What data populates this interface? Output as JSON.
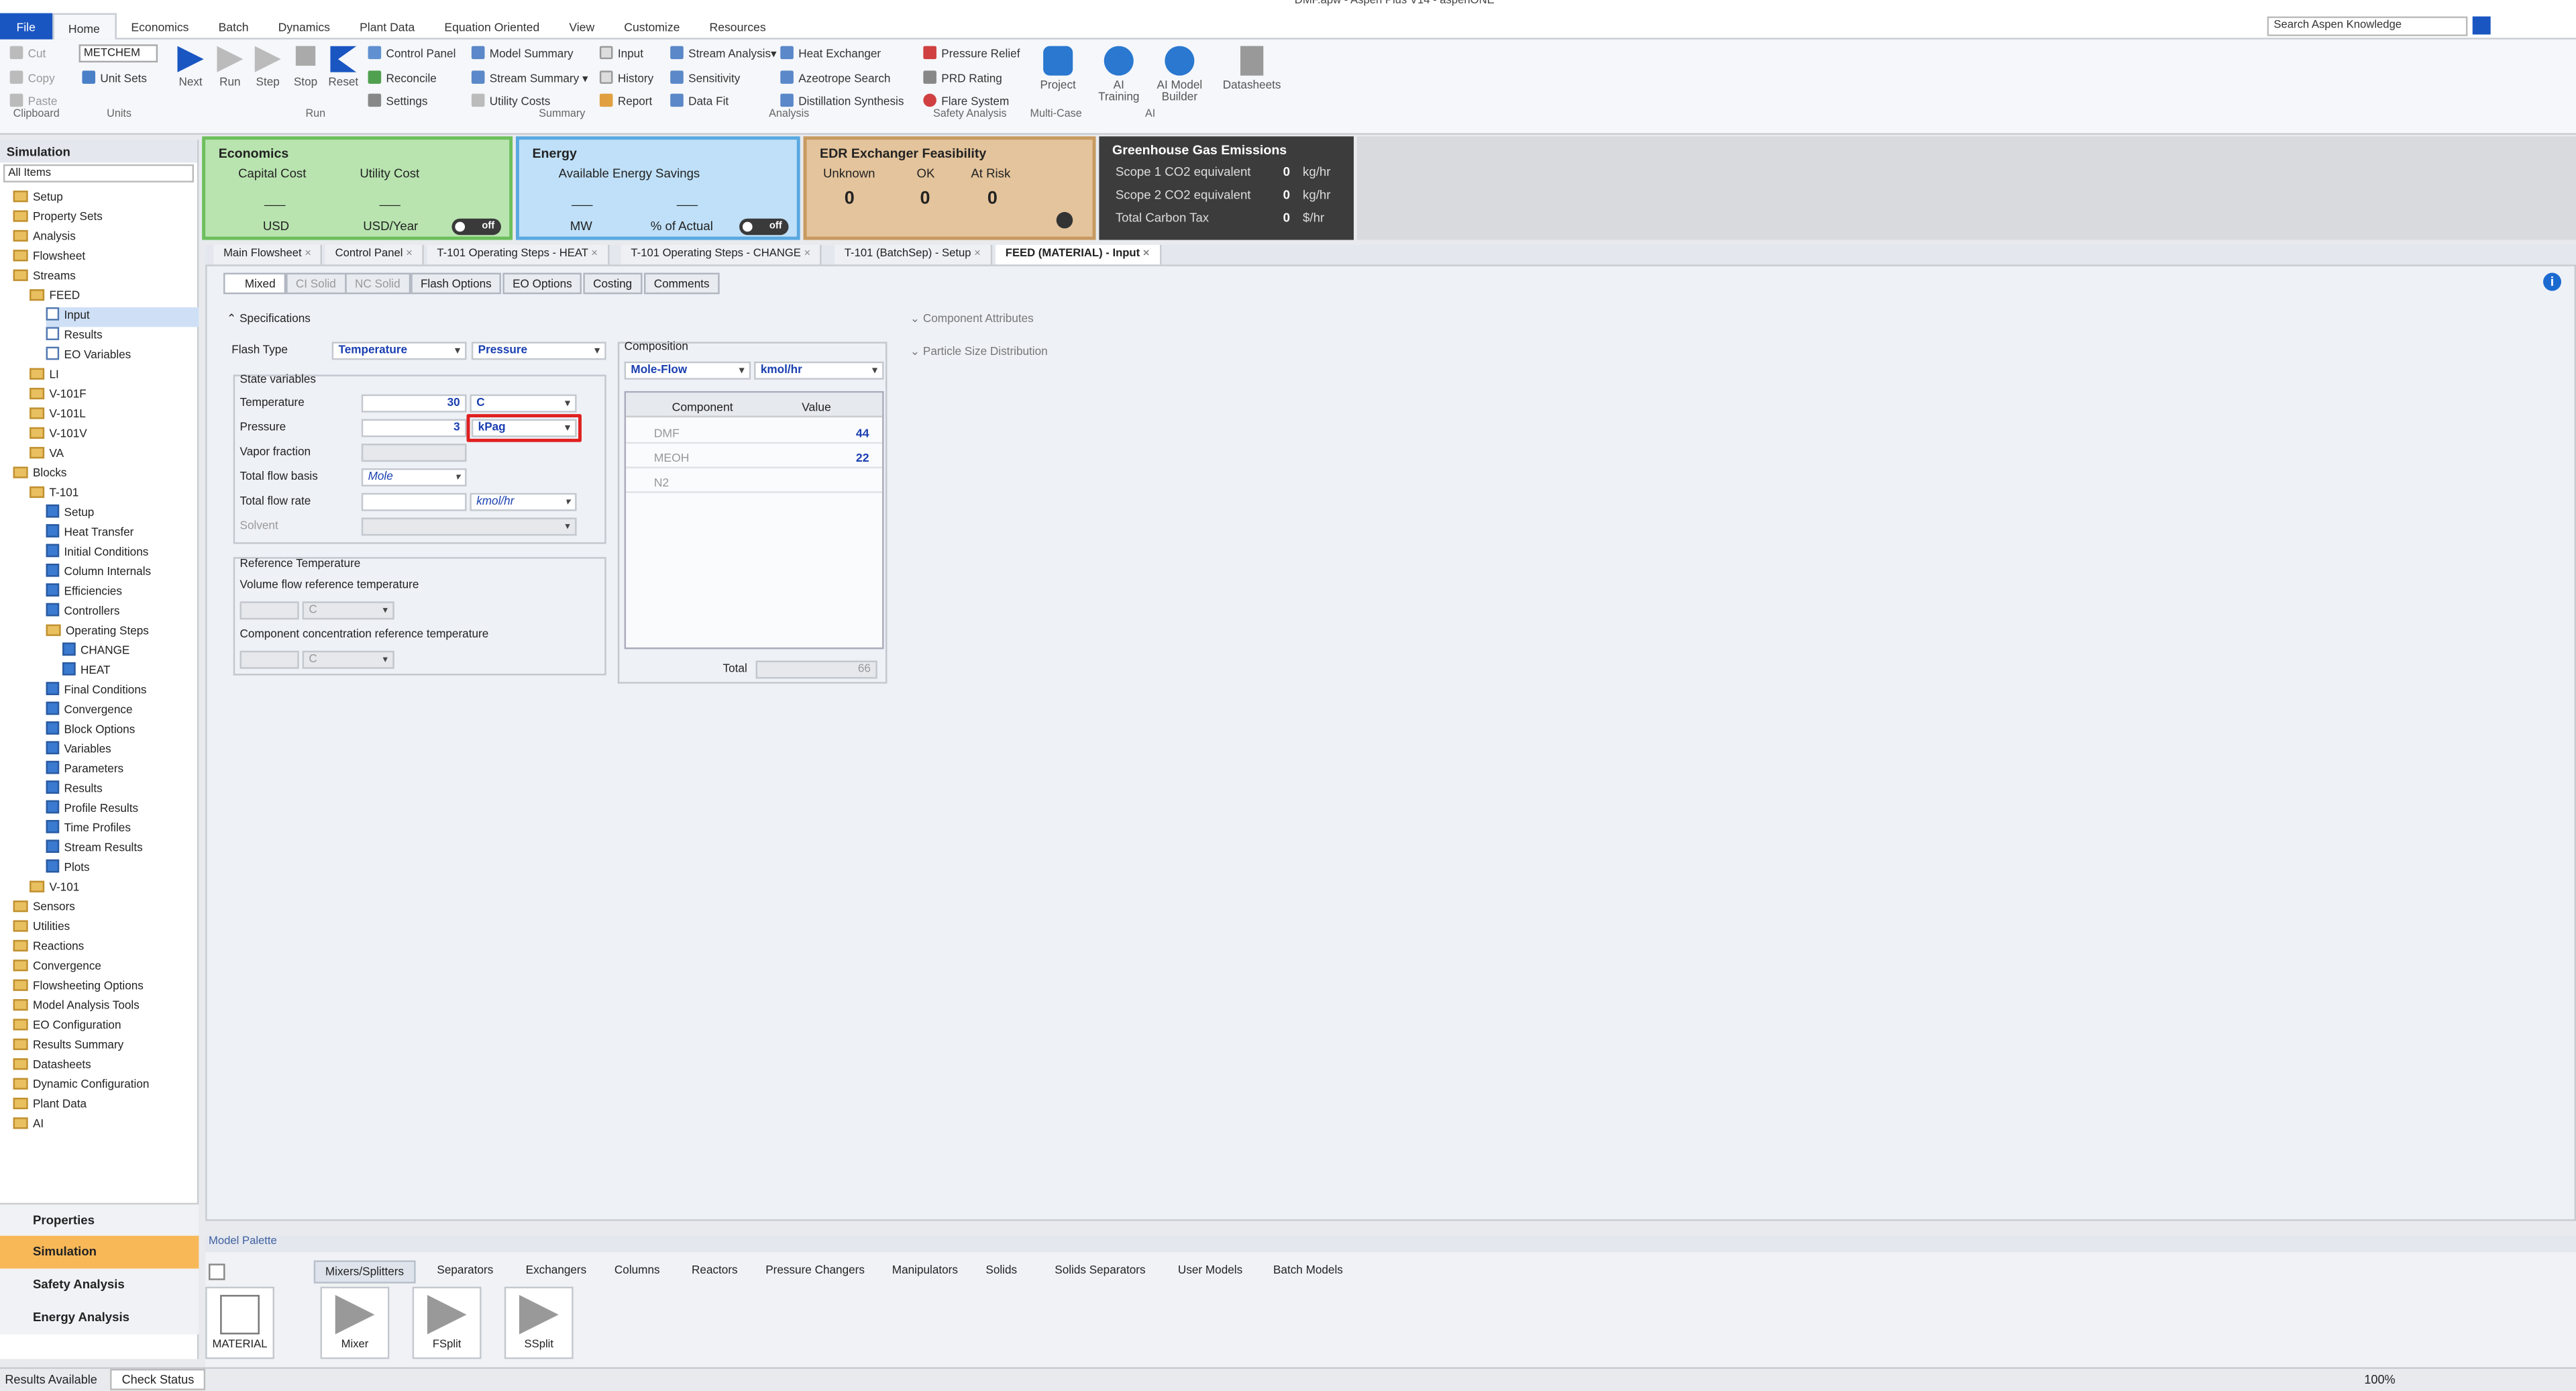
{
  "window_title": "DMF.apw - Aspen Plus V14 - aspenONE",
  "ribbon_tabs": [
    "File",
    "Home",
    "Economics",
    "Batch",
    "Dynamics",
    "Plant Data",
    "Equation Oriented",
    "View",
    "Customize",
    "Resources"
  ],
  "search_placeholder": "Search Aspen Knowledge",
  "clipboard": {
    "cut": "Cut",
    "copy": "Copy",
    "paste": "Paste",
    "label": "Clipboard"
  },
  "units": {
    "value": "METCHEM",
    "unit_sets": "Unit Sets",
    "label": "Units"
  },
  "run": {
    "next": "Next",
    "run": "Run",
    "step": "Step",
    "stop": "Stop",
    "reset": "Reset",
    "control_panel": "Control Panel",
    "reconcile": "Reconcile",
    "settings": "Settings",
    "label": "Run"
  },
  "summary": {
    "model_summary": "Model Summary",
    "stream_summary": "Stream Summary",
    "utility_costs": "Utility Costs",
    "input": "Input",
    "history": "History",
    "report": "Report",
    "label": "Summary"
  },
  "analysis": {
    "stream_analysis": "Stream Analysis",
    "sensitivity": "Sensitivity",
    "data_fit": "Data Fit",
    "heat_exchanger": "Heat Exchanger",
    "azeotrope_search": "Azeotrope Search",
    "distillation_synthesis": "Distillation Synthesis",
    "label": "Analysis"
  },
  "safety": {
    "pressure_relief": "Pressure Relief",
    "prd_rating": "PRD Rating",
    "flare_system": "Flare System",
    "label": "Safety Analysis"
  },
  "multicase": {
    "project": "Project",
    "label": "Multi-Case"
  },
  "ai": {
    "training": "AI Training",
    "model_builder": "AI Model Builder",
    "label": "AI"
  },
  "datasheets": "Datasheets",
  "economics": {
    "title": "Economics",
    "capital": "Capital Cost",
    "utility": "Utility Cost",
    "capital_val": "___",
    "utility_val": "___",
    "capital_unit": "USD",
    "utility_unit": "USD/Year",
    "toggle": "off"
  },
  "energy": {
    "title": "Energy",
    "savings": "Available Energy Savings",
    "val1": "___",
    "val2": "___",
    "unit1": "MW",
    "unit2": "% of Actual",
    "toggle": "off"
  },
  "edr": {
    "title": "EDR Exchanger Feasibility",
    "unknown": "Unknown",
    "ok": "OK",
    "at_risk": "At Risk",
    "unknown_val": "0",
    "ok_val": "0",
    "risk_val": "0"
  },
  "ghg": {
    "title": "Greenhouse Gas Emissions",
    "scope1": "Scope 1 CO2 equivalent",
    "scope2": "Scope 2 CO2 equivalent",
    "tax": "Total Carbon Tax",
    "scope1_val": "0",
    "scope2_val": "0",
    "tax_val": "0",
    "scope1_unit": "kg/hr",
    "scope2_unit": "kg/hr",
    "tax_unit": "$/hr"
  },
  "nav": {
    "header": "Simulation",
    "filter": "All Items",
    "items": [
      "Setup",
      "Property Sets",
      "Analysis",
      "Flowsheet",
      "Streams",
      "FEED",
      "Input",
      "Results",
      "EO Variables",
      "LI",
      "V-101F",
      "V-101L",
      "V-101V",
      "VA",
      "Blocks",
      "T-101",
      "Setup",
      "Heat Transfer",
      "Initial Conditions",
      "Column Internals",
      "Efficiencies",
      "Controllers",
      "Operating Steps",
      "CHANGE",
      "HEAT",
      "Final Conditions",
      "Convergence",
      "Block Options",
      "Variables",
      "Parameters",
      "Results",
      "Profile Results",
      "Time Profiles",
      "Stream Results",
      "Plots",
      "V-101",
      "Sensors",
      "Utilities",
      "Reactions",
      "Convergence",
      "Flowsheeting Options",
      "Model Analysis Tools",
      "EO Configuration",
      "Results Summary",
      "Datasheets",
      "Dynamic Configuration",
      "Plant Data",
      "AI"
    ],
    "bottom": [
      "Properties",
      "Simulation",
      "Safety Analysis",
      "Energy Analysis"
    ]
  },
  "doc_tabs": [
    "Main Flowsheet",
    "Control Panel",
    "T-101 Operating Steps - HEAT",
    "T-101 Operating Steps - CHANGE",
    "T-101 (BatchSep) - Setup",
    "FEED (MATERIAL) - Input"
  ],
  "sub_tabs": [
    "Mixed",
    "CI Solid",
    "NC Solid",
    "Flash Options",
    "EO Options",
    "Costing",
    "Comments"
  ],
  "form": {
    "specifications": "Specifications",
    "flash_type": "Flash Type",
    "flash1": "Temperature",
    "flash2": "Pressure",
    "state_vars": "State variables",
    "temperature": "Temperature",
    "temp_val": "30",
    "temp_unit": "C",
    "pressure": "Pressure",
    "press_val": "3",
    "press_unit": "kPag",
    "vapor": "Vapor fraction",
    "basis": "Total flow basis",
    "basis_val": "Mole",
    "flow_rate": "Total flow rate",
    "flow_unit": "kmol/hr",
    "solvent": "Solvent",
    "ref_temp": "Reference Temperature",
    "vol_ref": "Volume flow reference temperature",
    "vol_ref_unit": "C",
    "comp_ref": "Component concentration reference temperature",
    "comp_ref_unit": "C",
    "composition": "Composition",
    "comp_basis": "Mole-Flow",
    "comp_unit": "kmol/hr",
    "col_component": "Component",
    "col_value": "Value",
    "rows": [
      {
        "c": "DMF",
        "v": "44"
      },
      {
        "c": "MEOH",
        "v": "22"
      },
      {
        "c": "N2",
        "v": ""
      }
    ],
    "total": "Total",
    "total_val": "66",
    "attrs": "Component Attributes",
    "psd": "Particle Size Distribution"
  },
  "palette": {
    "title": "Model Palette",
    "tabs": [
      "Mixers/Splitters",
      "Separators",
      "Exchangers",
      "Columns",
      "Reactors",
      "Pressure Changers",
      "Manipulators",
      "Solids",
      "Solids Separators",
      "User Models",
      "Batch Models"
    ],
    "items": [
      "MATERIAL",
      "Mixer",
      "FSplit",
      "SSplit"
    ]
  },
  "status": {
    "left": "Results Available",
    "check": "Check Status",
    "zoom": "100%"
  }
}
